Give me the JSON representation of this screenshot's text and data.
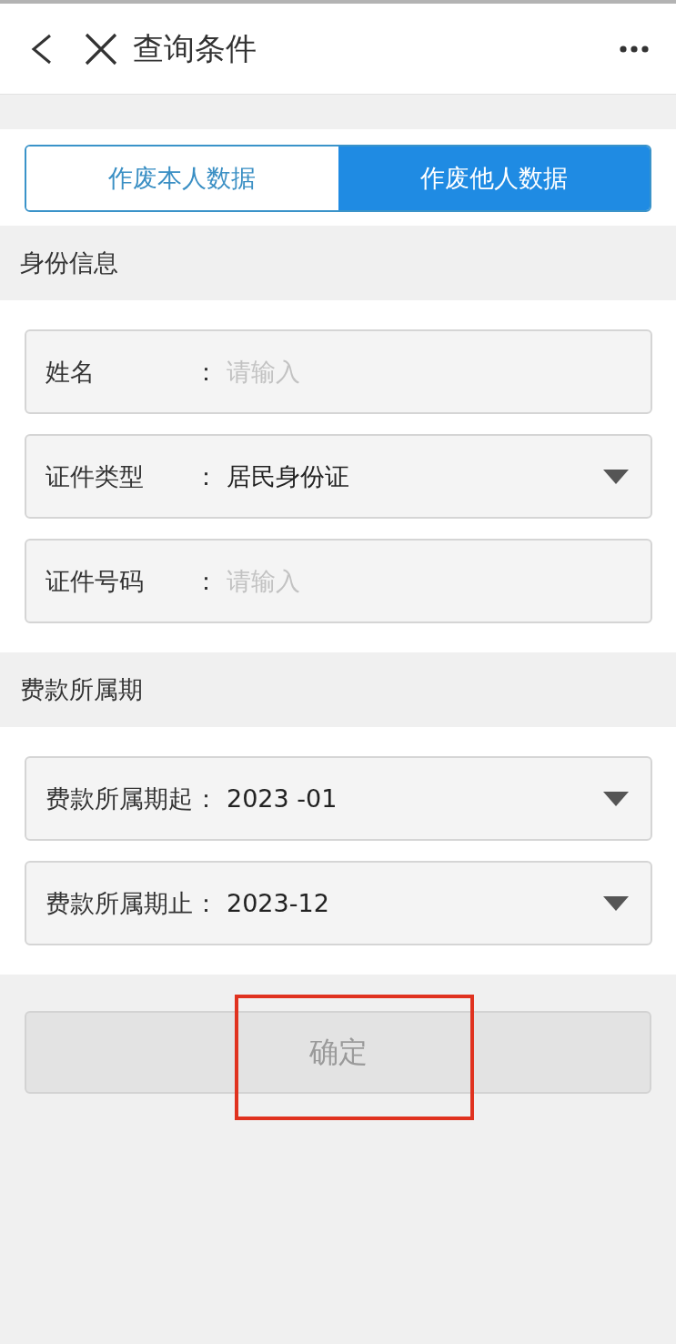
{
  "header": {
    "title": "查询条件"
  },
  "tabs": [
    {
      "label": "作废本人数据",
      "selected": false
    },
    {
      "label": "作废他人数据",
      "selected": true
    }
  ],
  "sections": [
    {
      "title": "身份信息",
      "fields": [
        {
          "kind": "text",
          "label": "姓名",
          "separator": "：",
          "placeholder": "请输入"
        },
        {
          "kind": "select",
          "label": "证件类型",
          "separator": "：",
          "value": "居民身份证"
        },
        {
          "kind": "text",
          "label": "证件号码",
          "separator": "：",
          "placeholder": "请输入"
        }
      ]
    },
    {
      "title": "费款所属期",
      "fields": [
        {
          "kind": "select",
          "label": "费款所属期起",
          "separator": "：",
          "value": "2023 -01"
        },
        {
          "kind": "select",
          "label": "费款所属期止",
          "separator": "：",
          "value": "2023-12"
        }
      ]
    }
  ],
  "submit": {
    "label": "确定",
    "disabled": true
  }
}
